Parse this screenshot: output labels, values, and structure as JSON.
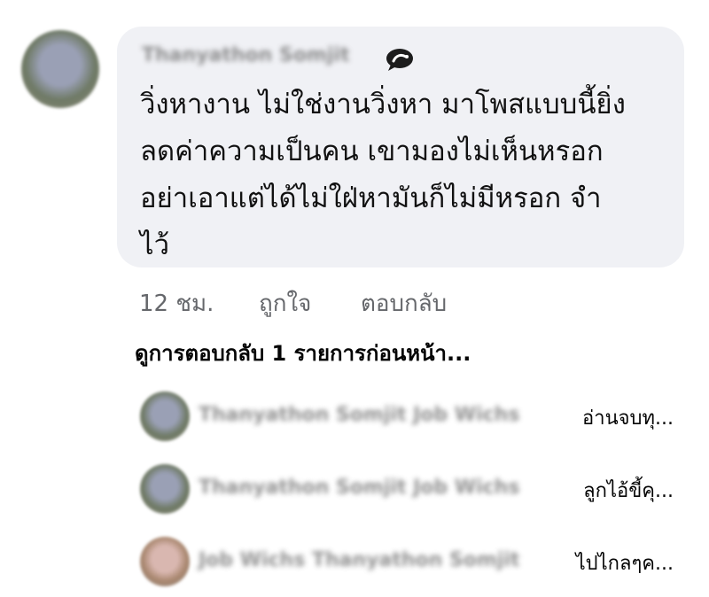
{
  "comment": {
    "author": "Thanyathon Somjit",
    "text": "วิ่งหางาน ไม่ใช่งานวิ่งหา มาโพสแบบนี้ยิ่ง\nลดค่าความเป็นคน เขามองไม่เห็นหรอก\nอย่าเอาแต่ได้ไม่ใฝ่หามันก็ไม่มีหรอก จำ\nไว้",
    "icon": "comment-bubble-icon"
  },
  "actions": {
    "time": "12 ชม.",
    "like": "ถูกใจ",
    "reply": "ตอบกลับ"
  },
  "view_previous": "ดูการตอบกลับ 1 รายการก่อนหน้า...",
  "replies": [
    {
      "name": "Thanyathon Somjit Job Wichs",
      "snippet": "อ่านจบทุ..."
    },
    {
      "name": "Thanyathon Somjit Job Wichs",
      "snippet": "ลูกไอ้ขี้คุ..."
    },
    {
      "name": "Job Wichs Thanyathon Somjit",
      "snippet": "ไปไกลๆค..."
    }
  ]
}
